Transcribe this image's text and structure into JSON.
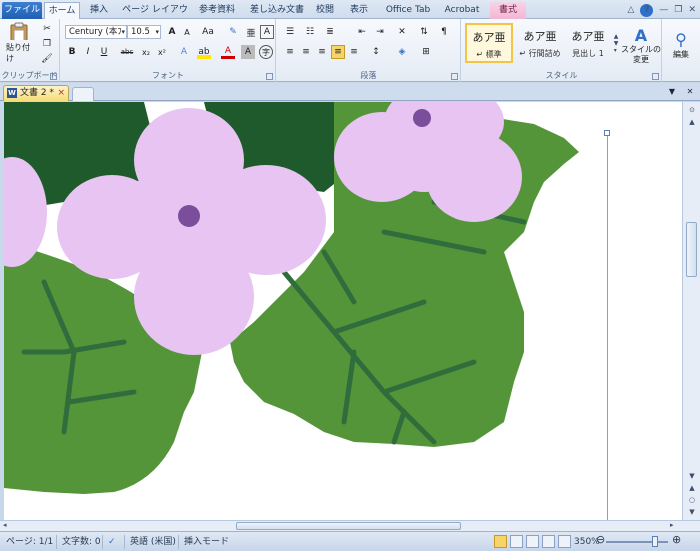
{
  "ribbon_tabs": {
    "file": "ファイル",
    "home": "ホーム",
    "insert": "挿入",
    "page_layout": "ページ レイアウト",
    "references": "参考資料",
    "mailings": "差し込み文書",
    "review": "校閲",
    "view": "表示",
    "office_tab": "Office Tab",
    "acrobat": "Acrobat",
    "format": "書式"
  },
  "clipboard": {
    "paste_label": "貼り付け",
    "group_label": "クリップボード"
  },
  "font": {
    "font_name": "Century (本ﾌ",
    "font_size": "10.5",
    "group_label": "フォント",
    "bold": "B",
    "italic": "I",
    "underline": "U",
    "strike": "abc",
    "subscript": "x₂",
    "superscript": "x²",
    "grow": "A",
    "shrink": "A",
    "case": "Aa",
    "clear": "A",
    "color_a": "A"
  },
  "paragraph": {
    "group_label": "段落"
  },
  "styles": {
    "group_label": "スタイル",
    "items": [
      {
        "preview": "あア亜",
        "name": "↵ 標準"
      },
      {
        "preview": "あア亜",
        "name": "↵ 行間詰め"
      },
      {
        "preview": "あア亜",
        "name": "見出し 1"
      }
    ],
    "change_styles": "スタイルの\n変更"
  },
  "editing": {
    "label": "編集"
  },
  "document_tab": {
    "title": "文書 2 *",
    "close": "×"
  },
  "status_bar": {
    "page": "ページ: 1/1",
    "word_count": "文字数: 0",
    "language": "英語 (米国)",
    "mode": "挿入モード",
    "zoom": "350%"
  },
  "colors": {
    "ribbon_accent": "#1f5fb4",
    "petal": "#e7c4f1",
    "leaf": "#5a9a3a",
    "vein": "#2f6d3c",
    "dark_leaf": "#1f5a2c",
    "center": "#8a5fa6"
  }
}
